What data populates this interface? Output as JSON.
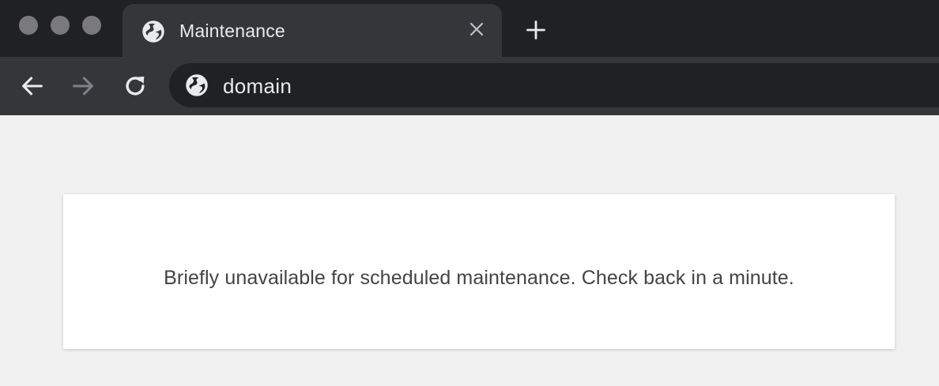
{
  "browser": {
    "tab": {
      "title": "Maintenance",
      "icon": "globe-icon",
      "close_icon": "close-icon"
    },
    "new_tab_icon": "plus-icon",
    "toolbar": {
      "back_icon": "arrow-left-icon",
      "forward_icon": "arrow-right-icon",
      "reload_icon": "reload-icon",
      "address": "domain",
      "address_icon": "globe-icon"
    },
    "colors": {
      "tabstrip": "#202124",
      "tab_active": "#35363a",
      "toolbar": "#35363a",
      "omnibox": "#202124",
      "text_light": "#e8eaed"
    }
  },
  "page": {
    "message": "Briefly unavailable for scheduled maintenance. Check back in a minute.",
    "colors": {
      "background": "#f1f1f1",
      "card": "#ffffff",
      "text": "#444444"
    }
  }
}
